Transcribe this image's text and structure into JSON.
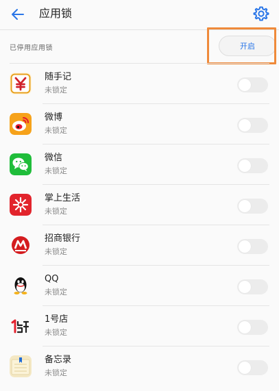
{
  "header": {
    "title": "应用锁",
    "back_icon": "arrow-left-icon",
    "settings_icon": "gear-icon"
  },
  "status": {
    "text": "已停用应用锁",
    "button_label": "开启"
  },
  "colors": {
    "accent": "#2a76e8",
    "highlight_box": "#ef8a3a"
  },
  "apps": [
    {
      "name": "随手记",
      "status": "未锁定",
      "icon": "suishouji-icon",
      "locked": false
    },
    {
      "name": "微博",
      "status": "未锁定",
      "icon": "weibo-icon",
      "locked": false
    },
    {
      "name": "微信",
      "status": "未锁定",
      "icon": "wechat-icon",
      "locked": false
    },
    {
      "name": "掌上生活",
      "status": "未锁定",
      "icon": "zhangshangshenghuo-icon",
      "locked": false
    },
    {
      "name": "招商银行",
      "status": "未锁定",
      "icon": "cmb-bank-icon",
      "locked": false
    },
    {
      "name": "QQ",
      "status": "未锁定",
      "icon": "qq-icon",
      "locked": false
    },
    {
      "name": "1号店",
      "status": "未锁定",
      "icon": "yhd-icon",
      "locked": false
    },
    {
      "name": "备忘录",
      "status": "未锁定",
      "icon": "memo-icon",
      "locked": false
    }
  ]
}
